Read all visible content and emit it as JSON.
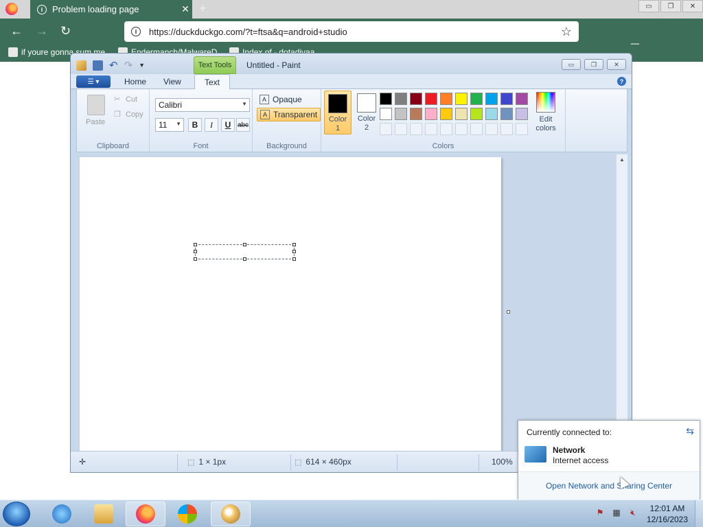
{
  "browser": {
    "tab_title": "Problem loading page",
    "tab_close": "✕",
    "new_tab": "+",
    "url": "https://duckduckgo.com/?t=ftsa&q=android+studio",
    "bookmarks": [
      "if youre gonna sum me",
      "Endermanch/MalwareD",
      "Index of - dotadivaa"
    ],
    "window_controls": [
      "▭",
      "❐",
      "✕"
    ]
  },
  "paint": {
    "contextual_tab": "Text Tools",
    "window_title": "Untitled - Paint",
    "window_controls": [
      "▭",
      "❐",
      "✕"
    ],
    "tabs": [
      "Home",
      "View",
      "Text"
    ],
    "active_tab": "Text",
    "clipboard": {
      "paste": "Paste",
      "cut": "Cut",
      "copy": "Copy",
      "label": "Clipboard"
    },
    "font": {
      "family": "Calibri",
      "size": "11",
      "bold": "B",
      "italic": "I",
      "underline": "U",
      "strike": "abc",
      "label": "Font"
    },
    "background": {
      "opaque": "Opaque",
      "transparent": "Transparent",
      "selected": "Transparent",
      "label": "Background"
    },
    "colors": {
      "color1_label": "Color",
      "color1_num": "1",
      "color1_value": "#000000",
      "color2_label": "Color",
      "color2_num": "2",
      "color2_value": "#ffffff",
      "edit_label": "Edit",
      "edit_label2": "colors",
      "label": "Colors",
      "palette": [
        "#000000",
        "#7f7f7f",
        "#880015",
        "#ed1c24",
        "#ff7f27",
        "#fff200",
        "#22b14c",
        "#00a2e8",
        "#3f48cc",
        "#a349a4",
        "#ffffff",
        "#c3c3c3",
        "#b97a57",
        "#ffaec9",
        "#ffc90e",
        "#efe4b0",
        "#b5e61d",
        "#99d9ea",
        "#7092be",
        "#c8bfe7"
      ],
      "empty_slots": 10
    },
    "status": {
      "selection_size": "1 × 1px",
      "canvas_size": "614 × 460px",
      "zoom": "100%"
    }
  },
  "network_popup": {
    "header": "Currently connected to:",
    "network_name": "Network",
    "network_status": "Internet access",
    "link": "Open Network and Sharing Center"
  },
  "taskbar": {
    "time": "12:01 AM",
    "date": "12/16/2023"
  }
}
